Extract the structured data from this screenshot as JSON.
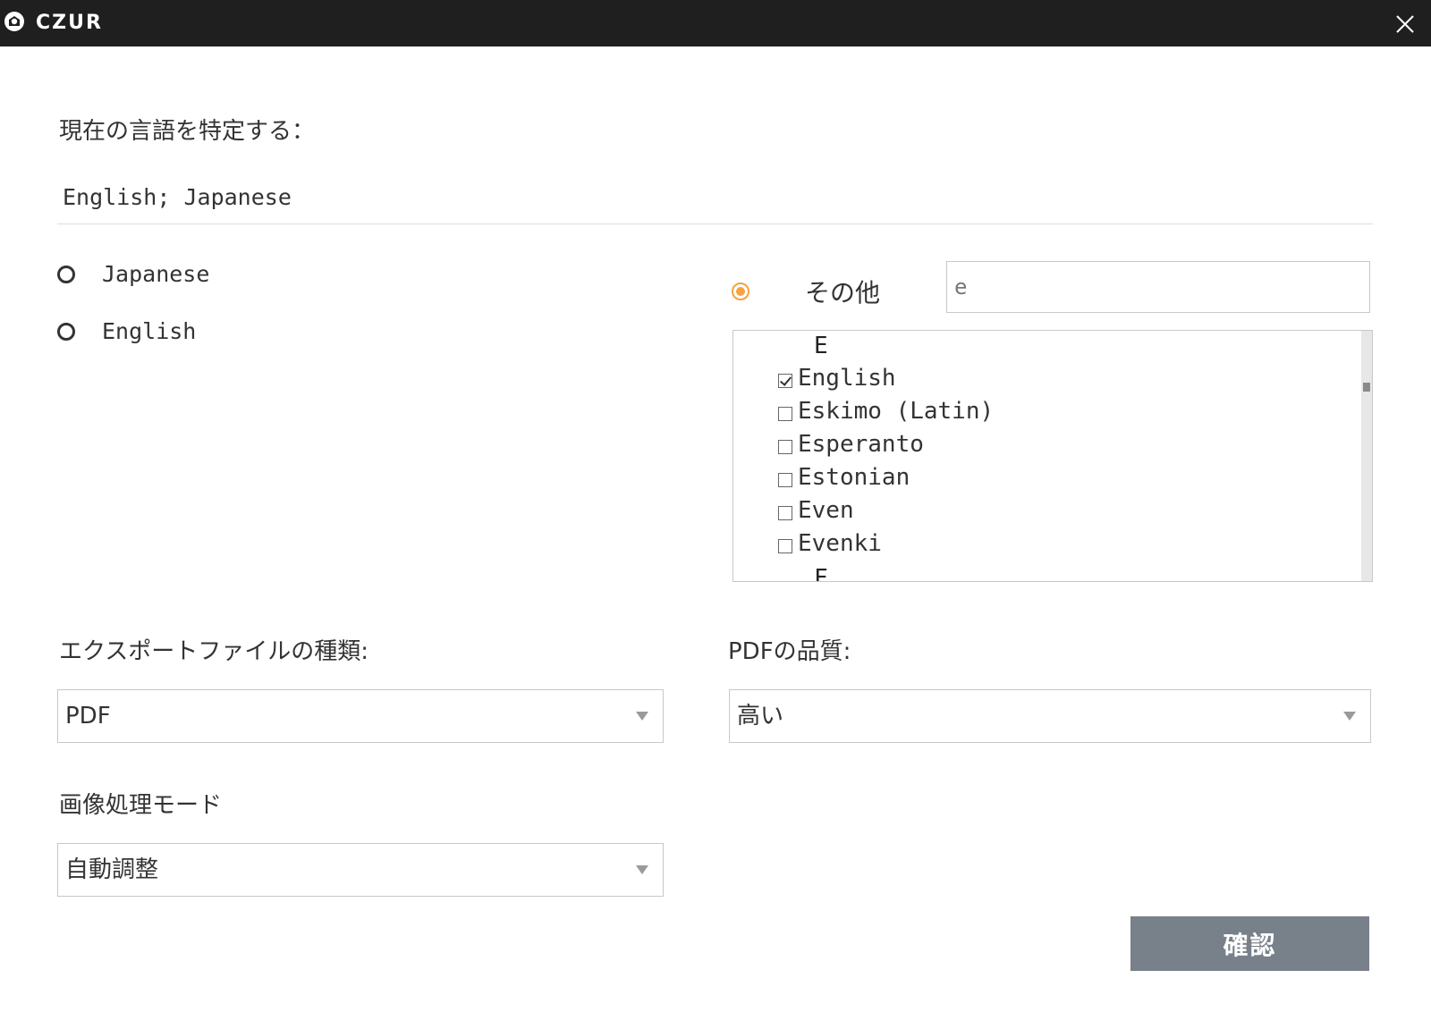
{
  "window": {
    "brand": "CZUR"
  },
  "language": {
    "section_label": "現在の言語を特定する：",
    "current_value": "English; Japanese",
    "options": [
      {
        "label": "Japanese",
        "selected": false
      },
      {
        "label": "English",
        "selected": false
      }
    ],
    "other": {
      "label": "その他",
      "selected": true,
      "search_value": "e"
    },
    "list": {
      "heading": "E",
      "items": [
        {
          "label": "English",
          "checked": true
        },
        {
          "label": "Eskimo (Latin)",
          "checked": false
        },
        {
          "label": "Esperanto",
          "checked": false
        },
        {
          "label": "Estonian",
          "checked": false
        },
        {
          "label": "Even",
          "checked": false
        },
        {
          "label": "Evenki",
          "checked": false
        }
      ],
      "next_heading": "F"
    }
  },
  "export": {
    "type_label": "エクスポートファイルの種類:",
    "type_value": "PDF",
    "quality_label": "PDFの品質:",
    "quality_value": "高い",
    "mode_label": "画像処理モード",
    "mode_value": "自動調整"
  },
  "actions": {
    "confirm_label": "確認"
  },
  "colors": {
    "titlebar": "#1f1f1f",
    "accent_radio": "#f5a340",
    "confirm_button": "#78808a"
  }
}
